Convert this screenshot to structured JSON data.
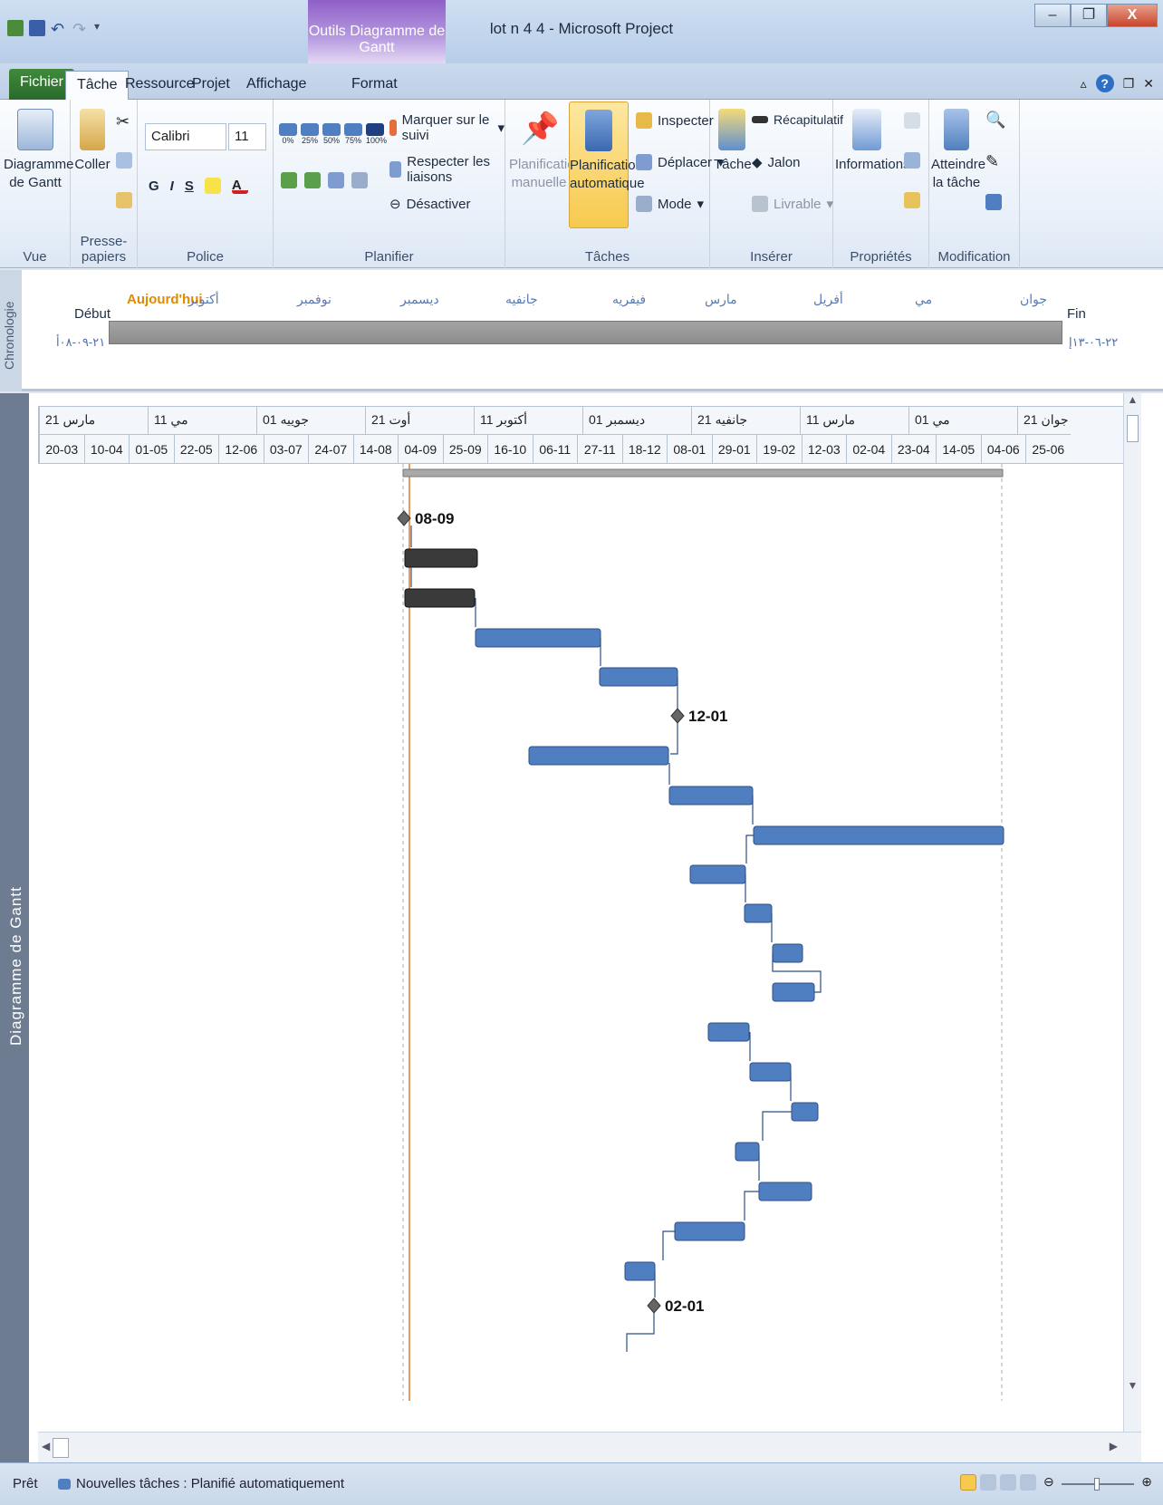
{
  "window": {
    "title": "lot n 4 4  -  Microsoft Project",
    "context_tab_title": "Outils Diagramme de Gantt"
  },
  "tabs": [
    "Fichier",
    "Tâche",
    "Ressource",
    "Projet",
    "Affichage",
    "Format"
  ],
  "ribbon": {
    "vue": {
      "label": "Vue",
      "gantt_btn": "Diagramme de Gantt"
    },
    "presse_papiers": {
      "label": "Presse-papiers",
      "coller": "Coller"
    },
    "police": {
      "label": "Police",
      "font": "Calibri",
      "size": "11",
      "bold": "G",
      "italic": "I",
      "underline": "S"
    },
    "planifier": {
      "label": "Planifier",
      "percent": [
        "0%",
        "25%",
        "50%",
        "75%",
        "100%"
      ],
      "marquer": "Marquer sur le suivi",
      "respecter": "Respecter les liaisons",
      "desactiver": "Désactiver"
    },
    "taches": {
      "label": "Tâches",
      "manuelle": "Planification manuelle",
      "automatique": "Planification automatique",
      "inspecter": "Inspecter",
      "deplacer": "Déplacer",
      "mode": "Mode"
    },
    "inserer": {
      "label": "Insérer",
      "tache": "Tâche",
      "recap": "Récapitulatif",
      "jalon": "Jalon",
      "livrable": "Livrable"
    },
    "proprietes": {
      "label": "Propriétés",
      "informations": "Informations"
    },
    "modification": {
      "label": "Modification",
      "atteindre": "Atteindre la tâche"
    }
  },
  "timeline": {
    "side_label": "Chronologie",
    "today": "Aujourd'hui",
    "start_label": "Début",
    "end_label": "Fin",
    "start_date": "٢١-٠٩-٠٨أ",
    "end_date": "٢٢-٠٦-١٣إ",
    "months": [
      "أكتوبر",
      "نوفمبر",
      "ديسمبر",
      "جانفيه",
      "فيفريه",
      "مارس",
      "أفريل",
      "مي",
      "جوان"
    ]
  },
  "gantt": {
    "side_label": "Diagramme de Gantt",
    "top_tier": [
      "مارس 21",
      "مي 11",
      "جوييه 01",
      "أوت 21",
      "أكتوبر 11",
      "ديسمبر 01",
      "جانفيه 21",
      "مارس 11",
      "مي 01",
      "جوان 21"
    ],
    "bottom_tier": [
      "20-03",
      "10-04",
      "01-05",
      "22-05",
      "12-06",
      "03-07",
      "24-07",
      "14-08",
      "04-09",
      "25-09",
      "16-10",
      "06-11",
      "27-11",
      "18-12",
      "08-01",
      "29-01",
      "19-02",
      "12-03",
      "02-04",
      "23-04",
      "14-05",
      "04-06",
      "25-06"
    ],
    "milestones": [
      "08-09",
      "12-01",
      "02-01"
    ]
  },
  "status": {
    "ready": "Prêt",
    "new_tasks": "Nouvelles tâches : Planifié automatiquement"
  },
  "colors": {
    "task": "#4f7fc0",
    "summary": "#3a3a3a",
    "today_line": "#e07a2a",
    "ribbon_active": "#f7c94e"
  }
}
